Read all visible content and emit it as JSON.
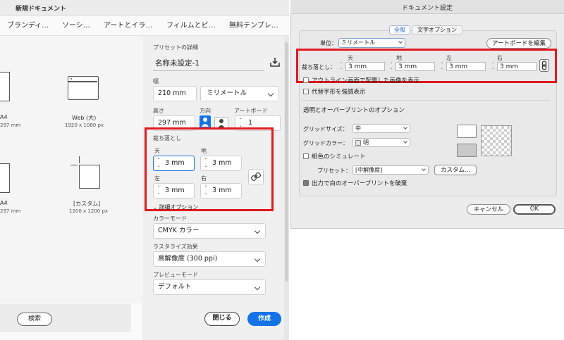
{
  "left_window": {
    "title": "新規ドキュメント",
    "category_tabs": [
      "ブランディ…",
      "ソーシ…",
      "アートとイラ…",
      "フィルムとビ…",
      "無料テンプレ…"
    ],
    "presets": [
      {
        "label": "A4",
        "size": "297 mm"
      },
      {
        "label": "Web (大)",
        "size": "1920 x 1080 px"
      },
      {
        "label": "A4",
        "size": "297 mm"
      },
      {
        "label": "[カスタム]",
        "size": "1200 x 1200 px"
      }
    ],
    "search_label": "検索",
    "details": {
      "section_title": "プリセットの詳細",
      "doc_name": "名称未設定-1",
      "width_label": "幅",
      "width_value": "210 mm",
      "unit_value": "ミリメートル",
      "height_label": "高さ",
      "height_value": "297 mm",
      "orientation_label": "方向",
      "artboard_label": "アートボード",
      "artboard_value": "1",
      "bleed_title": "裁ち落とし",
      "top_label": "天",
      "top_value": "3 mm",
      "bottom_label": "地",
      "bottom_value": "3 mm",
      "left_label": "左",
      "left_value": "3 mm",
      "right_label": "右",
      "right_value": "3 mm",
      "advanced_label": "詳細オプション",
      "color_mode_label": "カラーモード",
      "color_mode_value": "CMYK カラー",
      "raster_label": "ラスタライズ効果",
      "raster_value": "高解像度 (300 ppi)",
      "preview_label": "プレビューモード",
      "preview_value": "デフォルト"
    },
    "close_label": "閉じる",
    "create_label": "作成"
  },
  "dialog": {
    "title": "ドキュメント設定",
    "tabs": [
      "全般",
      "文字オプション"
    ],
    "unit_label": "単位：",
    "unit_value": "ミリメートル",
    "edit_artboard_label": "アートボードを編集",
    "bleed_label": "裁ち落とし：",
    "col_top": "天",
    "col_bottom": "地",
    "col_left": "左",
    "col_right": "右",
    "top_value": "3 mm",
    "bottom_value": "3 mm",
    "left_value": "3 mm",
    "right_value": "3 mm",
    "outline_option": "アウトライン画面で配置した画像を表示",
    "substitute_option": "代替字形を強調表示",
    "transparency_section": "透明とオーバープリントのオプション",
    "grid_size_label": "グリッドサイズ：",
    "grid_size_value": "中",
    "grid_color_label": "グリッドカラー：",
    "grid_color_value": "明",
    "paper_sim_label": "紙色のシミュレート",
    "preset_label": "プリセット：",
    "preset_value": "[中解像度]",
    "custom_label": "カスタム...",
    "discard_overprint_label": "出力で白のオーバープリントを破棄",
    "cancel_label": "キャンセル",
    "ok_label": "OK"
  }
}
